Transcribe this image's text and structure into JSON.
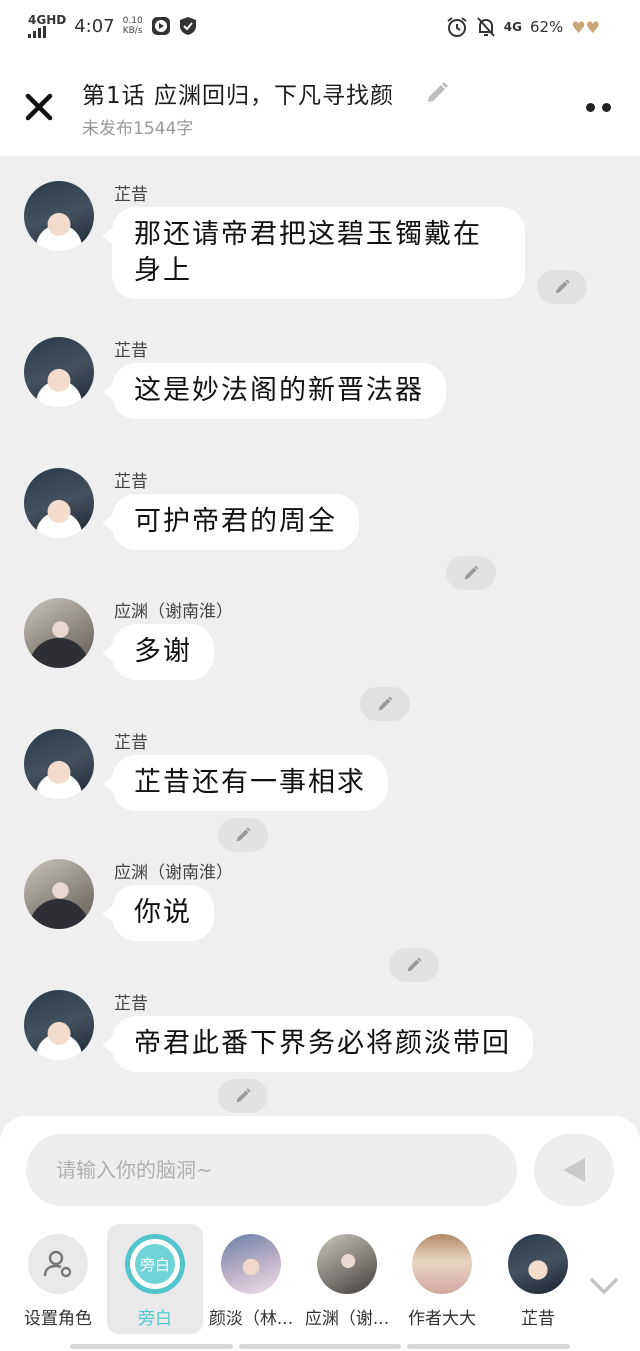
{
  "status_bar": {
    "network": "4GHD",
    "time": "4:07",
    "speed_value": "0.10",
    "speed_unit": "KB/s",
    "network_right": "4G",
    "battery": "62%"
  },
  "header": {
    "title": "第1话  应渊回归，下凡寻找颜",
    "subtitle": "未发布1544字"
  },
  "messages": [
    {
      "sender": "芷昔",
      "text": "那还请帝君把这碧玉镯戴在身上",
      "avatar": "ge"
    },
    {
      "sender": "芷昔",
      "text": "这是妙法阁的新晋法器",
      "avatar": "ge"
    },
    {
      "sender": "芷昔",
      "text": "可护帝君的周全",
      "avatar": "ge"
    },
    {
      "sender": "应渊（谢南淮）",
      "text": "多谢",
      "avatar": "ying"
    },
    {
      "sender": "芷昔",
      "text": "芷昔还有一事相求",
      "avatar": "ge"
    },
    {
      "sender": "应渊（谢南淮）",
      "text": "你说",
      "avatar": "ying"
    },
    {
      "sender": "芷昔",
      "text": "帝君此番下界务必将颜淡带回",
      "avatar": "ge"
    }
  ],
  "composer": {
    "placeholder": "请输入你的脑洞~"
  },
  "roles": [
    {
      "label": "设置角色",
      "icon": "person-settings-icon"
    },
    {
      "label": "旁白",
      "badge": "旁白",
      "active": true
    },
    {
      "label": "颜淡（林..."
    },
    {
      "label": "应渊（谢..."
    },
    {
      "label": "作者大大"
    },
    {
      "label": "芷昔"
    }
  ],
  "colors": {
    "accent": "#52c5cc",
    "background": "#efefef",
    "bubble": "#ffffff"
  }
}
